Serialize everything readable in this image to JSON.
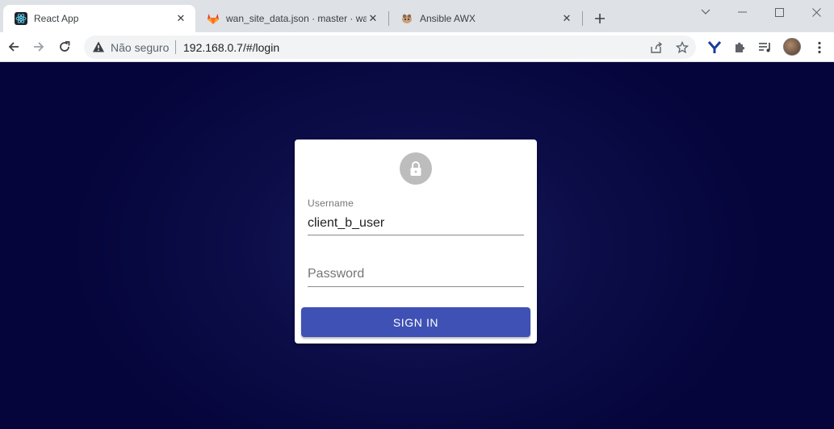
{
  "browser": {
    "tabs": [
      {
        "title": "React App",
        "icon": "react-icon"
      },
      {
        "title": "wan_site_data.json · master · wan",
        "icon": "gitlab-icon"
      },
      {
        "title": "Ansible AWX",
        "icon": "awx-icon"
      }
    ],
    "address": {
      "security_label": "Não seguro",
      "url": "192.168.0.7/#/login"
    }
  },
  "login": {
    "username_label": "Username",
    "username_value": "client_b_user",
    "password_placeholder": "Password",
    "signin_label": "SIGN IN"
  },
  "colors": {
    "background": "#05053b",
    "button": "#3f51b5",
    "lock_circle": "#bdbdbd"
  }
}
